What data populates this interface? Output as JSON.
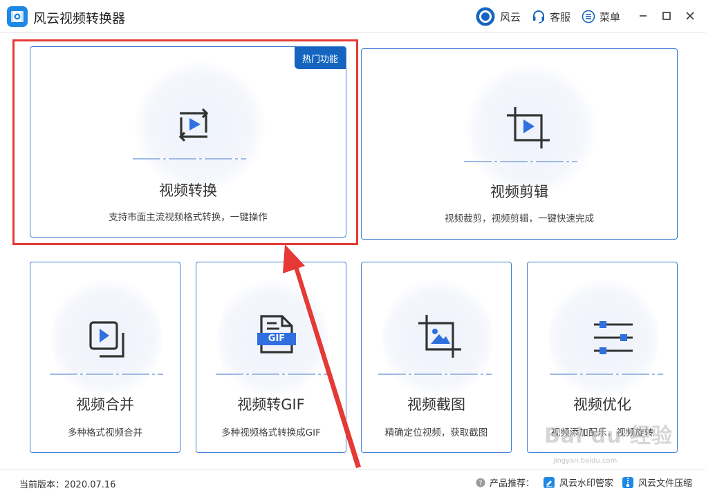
{
  "app": {
    "title": "风云视频转换器"
  },
  "toolbar": {
    "brand_label": "风云",
    "service_label": "客服",
    "menu_label": "菜单"
  },
  "cards": {
    "convert": {
      "title": "视频转换",
      "desc": "支持市面主流视频格式转换，一键操作",
      "badge": "热门功能"
    },
    "edit": {
      "title": "视频剪辑",
      "desc": "视频裁剪，视频剪辑，一键快速完成"
    },
    "merge": {
      "title": "视频合并",
      "desc": "多种格式视频合并"
    },
    "gif": {
      "title": "视频转GIF",
      "desc": "多种视频格式转换成GIF",
      "icon_text": "GIF"
    },
    "screenshot": {
      "title": "视频截图",
      "desc": "精确定位视频，获取截图"
    },
    "optimize": {
      "title": "视频优化",
      "desc": "视频添加配乐，视频旋转"
    }
  },
  "footer": {
    "version_label": "当前版本：",
    "version": "2020.07.16",
    "recommend_label": "产品推荐：",
    "product1": "风云水印管家",
    "product2": "风云文件压缩"
  },
  "watermark": {
    "main": "Bai du 经验",
    "sub": "jingyan.baidu.com"
  },
  "colors": {
    "accent": "#1565c0",
    "card_border": "#3a7bd5",
    "highlight": "#e53935",
    "icon_blue": "#2f6fe0"
  }
}
